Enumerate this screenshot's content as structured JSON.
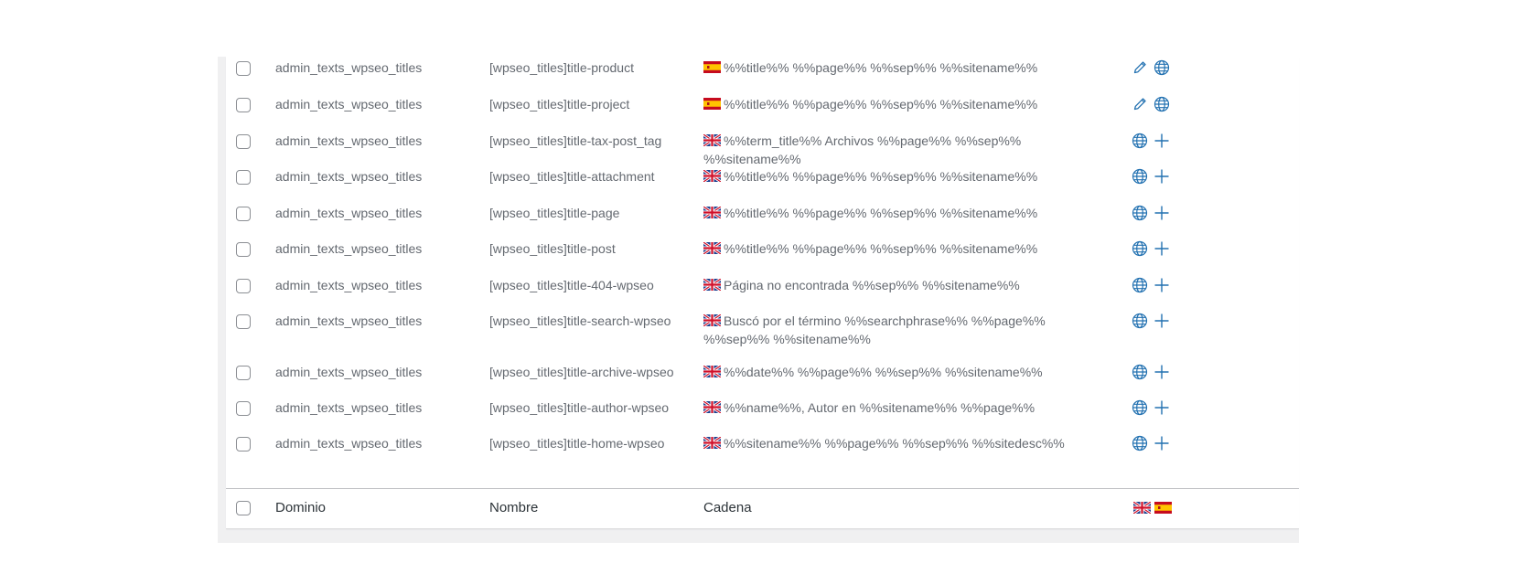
{
  "table": {
    "rows": [
      {
        "domain": "admin_texts_wpseo_titles",
        "name": "[wpseo_titles]title-product",
        "flag": "es",
        "string": "%%title%% %%page%% %%sep%% %%sitename%%",
        "actions": [
          "pencil-icon",
          "globe-icon"
        ]
      },
      {
        "domain": "admin_texts_wpseo_titles",
        "name": "[wpseo_titles]title-project",
        "flag": "es",
        "string": "%%title%% %%page%% %%sep%% %%sitename%%",
        "actions": [
          "pencil-icon",
          "globe-icon"
        ]
      },
      {
        "domain": "admin_texts_wpseo_titles",
        "name": "[wpseo_titles]title-tax-post_tag",
        "flag": "gb",
        "string": "%%term_title%% Archivos %%page%% %%sep%% %%sitename%%",
        "actions": [
          "globe-icon",
          "plus-icon"
        ]
      },
      {
        "domain": "admin_texts_wpseo_titles",
        "name": "[wpseo_titles]title-attachment",
        "flag": "gb",
        "string": "%%title%% %%page%% %%sep%% %%sitename%%",
        "actions": [
          "globe-icon",
          "plus-icon"
        ]
      },
      {
        "domain": "admin_texts_wpseo_titles",
        "name": "[wpseo_titles]title-page",
        "flag": "gb",
        "string": "%%title%% %%page%% %%sep%% %%sitename%%",
        "actions": [
          "globe-icon",
          "plus-icon"
        ]
      },
      {
        "domain": "admin_texts_wpseo_titles",
        "name": "[wpseo_titles]title-post",
        "flag": "gb",
        "string": "%%title%% %%page%% %%sep%% %%sitename%%",
        "actions": [
          "globe-icon",
          "plus-icon"
        ]
      },
      {
        "domain": "admin_texts_wpseo_titles",
        "name": "[wpseo_titles]title-404-wpseo",
        "flag": "gb",
        "string": "Página no encontrada %%sep%% %%sitename%%",
        "actions": [
          "globe-icon",
          "plus-icon"
        ]
      },
      {
        "domain": "admin_texts_wpseo_titles",
        "name": "[wpseo_titles]title-search-wpseo",
        "flag": "gb",
        "string": "Buscó por el término %%searchphrase%% %%page%% %%sep%% %%sitename%%",
        "actions": [
          "globe-icon",
          "plus-icon"
        ]
      },
      {
        "domain": "admin_texts_wpseo_titles",
        "name": "[wpseo_titles]title-archive-wpseo",
        "flag": "gb",
        "string": "%%date%% %%page%% %%sep%% %%sitename%%",
        "actions": [
          "globe-icon",
          "plus-icon"
        ]
      },
      {
        "domain": "admin_texts_wpseo_titles",
        "name": "[wpseo_titles]title-author-wpseo",
        "flag": "gb",
        "string": "%%name%%, Autor en %%sitename%% %%page%%",
        "actions": [
          "globe-icon",
          "plus-icon"
        ]
      },
      {
        "domain": "admin_texts_wpseo_titles",
        "name": "[wpseo_titles]title-home-wpseo",
        "flag": "gb",
        "string": "%%sitename%% %%page%% %%sep%% %%sitedesc%%",
        "actions": [
          "globe-icon",
          "plus-icon"
        ]
      }
    ],
    "footer": {
      "domain_header": "Dominio",
      "name_header": "Nombre",
      "string_header": "Cadena",
      "language_flags": [
        "gb",
        "es"
      ]
    }
  },
  "colors": {
    "icon": "#2271b1",
    "text": "#646970",
    "header_text": "#2c3338",
    "panel_bg": "#f0f0f1",
    "checkbox_border": "#8c8f94"
  }
}
